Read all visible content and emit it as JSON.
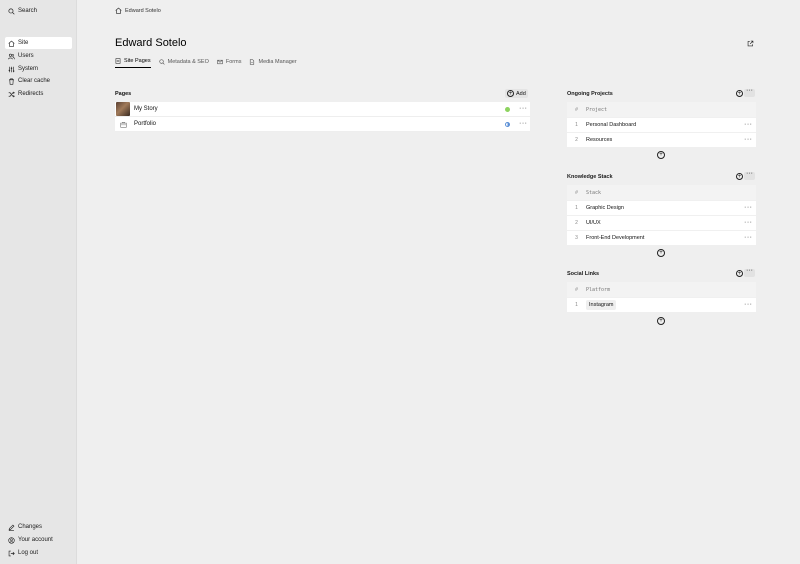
{
  "sidebar": {
    "search": "Search",
    "items": [
      {
        "label": "Site",
        "icon": "home-icon"
      },
      {
        "label": "Users",
        "icon": "users-icon"
      },
      {
        "label": "System",
        "icon": "sliders-icon"
      },
      {
        "label": "Clear cache",
        "icon": "trash-icon"
      },
      {
        "label": "Redirects",
        "icon": "shuffle-icon"
      }
    ],
    "bottom": [
      {
        "label": "Changes",
        "icon": "edit-icon"
      },
      {
        "label": "Your account",
        "icon": "account-icon"
      },
      {
        "label": "Log out",
        "icon": "logout-icon"
      }
    ]
  },
  "breadcrumb": "Edward Sotelo",
  "page_title": "Edward Sotelo",
  "tabs": [
    "Site Pages",
    "Metadata & SEO",
    "Forms",
    "Media Manager"
  ],
  "pages": {
    "title": "Pages",
    "add_label": "Add",
    "items": [
      {
        "title": "My Story",
        "status": "published"
      },
      {
        "title": "Portfolio",
        "status": "draft"
      }
    ]
  },
  "ongoing": {
    "title": "Ongoing Projects",
    "num_header": "#",
    "col_header": "Project",
    "rows": [
      {
        "n": "1",
        "v": "Personal Dashboard"
      },
      {
        "n": "2",
        "v": "Resources"
      }
    ]
  },
  "knowledge": {
    "title": "Knowledge Stack",
    "num_header": "#",
    "col_header": "Stack",
    "rows": [
      {
        "n": "1",
        "v": "Graphic Design"
      },
      {
        "n": "2",
        "v": "UI/UX"
      },
      {
        "n": "3",
        "v": "Front-End Development"
      }
    ]
  },
  "social": {
    "title": "Social Links",
    "num_header": "#",
    "col_header": "Platform",
    "rows": [
      {
        "n": "1",
        "v": "Instagram"
      }
    ]
  },
  "colors": {
    "sidebar_bg": "#e6e6e6",
    "main_bg": "#efefef",
    "published": "#8dd35f",
    "draft": "#5b8fd6"
  }
}
